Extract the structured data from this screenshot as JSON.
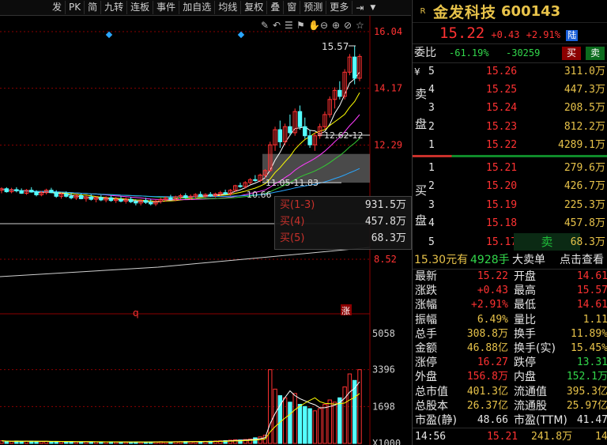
{
  "toolbar": {
    "items": [
      "发",
      "PK",
      "简",
      "九转",
      "连板",
      "事件",
      "加自选",
      "均线",
      "复权",
      "叠",
      "窗",
      "预测",
      "更多"
    ],
    "icons": [
      "pin-right-icon",
      "dropdown-triangle-icon"
    ]
  },
  "colors": {
    "up": "#ff3232",
    "down": "#54ffff",
    "ma5": "#ffffff",
    "ma10": "#ffff00",
    "ma20": "#ff3cff",
    "ma30": "#33cc33",
    "ma60": "#2aa7ff",
    "ma120": "#d0d0d0",
    "bg": "#000000",
    "grid": "#8b0000"
  },
  "price_axis": {
    "ticks": [
      "16.04",
      "14.17",
      "12.29",
      "8.52"
    ]
  },
  "volume_axis": {
    "ticks": [
      "5058",
      "3396",
      "1698",
      "X1000"
    ]
  },
  "chart_data": {
    "type": "candlestick",
    "price_range": [
      8.52,
      16.04
    ],
    "volume_range": [
      0,
      5058
    ],
    "annotations": {
      "high": "15.57",
      "range1": "12.62-12",
      "range2": "11.05-11.83",
      "low": "10.66",
      "marker_q": "q",
      "marker_zhang": "涨"
    },
    "candles": [
      [
        10.8,
        10.9,
        10.7,
        10.85
      ],
      [
        10.85,
        10.9,
        10.72,
        10.75
      ],
      [
        10.75,
        10.88,
        10.7,
        10.82
      ],
      [
        10.82,
        10.9,
        10.73,
        10.78
      ],
      [
        10.78,
        10.86,
        10.68,
        10.7
      ],
      [
        10.7,
        10.84,
        10.65,
        10.8
      ],
      [
        10.8,
        10.9,
        10.72,
        10.74
      ],
      [
        10.74,
        10.8,
        10.6,
        10.65
      ],
      [
        10.65,
        10.78,
        10.6,
        10.72
      ],
      [
        10.72,
        10.85,
        10.66,
        10.8
      ],
      [
        10.8,
        10.88,
        10.7,
        10.72
      ],
      [
        10.72,
        10.8,
        10.55,
        10.6
      ],
      [
        10.6,
        10.72,
        10.52,
        10.68
      ],
      [
        10.68,
        10.76,
        10.56,
        10.6
      ],
      [
        10.6,
        10.7,
        10.5,
        10.55
      ],
      [
        10.55,
        10.68,
        10.48,
        10.62
      ],
      [
        10.62,
        10.7,
        10.5,
        10.52
      ],
      [
        10.52,
        10.62,
        10.42,
        10.58
      ],
      [
        10.58,
        10.66,
        10.46,
        10.5
      ],
      [
        10.5,
        10.6,
        10.4,
        10.56
      ],
      [
        10.56,
        10.64,
        10.44,
        10.48
      ],
      [
        10.48,
        10.6,
        10.4,
        10.55
      ],
      [
        10.55,
        10.62,
        10.42,
        10.46
      ],
      [
        10.46,
        10.58,
        10.38,
        10.5
      ],
      [
        10.5,
        10.6,
        10.4,
        10.44
      ],
      [
        10.44,
        10.56,
        10.36,
        10.5
      ],
      [
        10.5,
        10.58,
        10.38,
        10.42
      ],
      [
        10.42,
        10.5,
        10.3,
        10.38
      ],
      [
        10.38,
        10.5,
        10.3,
        10.46
      ],
      [
        10.46,
        10.55,
        10.35,
        10.4
      ],
      [
        10.4,
        10.5,
        10.3,
        10.35
      ],
      [
        10.35,
        10.48,
        10.28,
        10.44
      ],
      [
        10.44,
        10.55,
        10.36,
        10.5
      ],
      [
        10.5,
        10.6,
        10.42,
        10.55
      ],
      [
        10.55,
        10.65,
        10.46,
        10.5
      ],
      [
        10.5,
        10.62,
        10.44,
        10.58
      ],
      [
        10.58,
        10.68,
        10.5,
        10.62
      ],
      [
        10.62,
        10.7,
        10.52,
        10.56
      ],
      [
        10.56,
        10.66,
        10.48,
        10.6
      ],
      [
        10.6,
        10.7,
        10.52,
        10.66
      ],
      [
        10.66,
        10.76,
        10.58,
        10.6
      ],
      [
        10.6,
        10.7,
        10.55,
        10.66
      ],
      [
        10.66,
        10.74,
        10.58,
        10.62
      ],
      [
        10.62,
        10.72,
        10.56,
        10.68
      ],
      [
        10.68,
        10.78,
        10.6,
        10.72
      ],
      [
        10.72,
        10.82,
        10.64,
        10.68
      ],
      [
        10.68,
        10.84,
        10.62,
        10.8
      ],
      [
        10.8,
        10.98,
        10.74,
        10.95
      ],
      [
        10.95,
        11.05,
        10.88,
        10.92
      ],
      [
        10.92,
        11.1,
        10.86,
        11.05
      ],
      [
        11.05,
        11.2,
        11.0,
        11.15
      ],
      [
        11.15,
        11.3,
        11.08,
        11.12
      ],
      [
        11.12,
        11.35,
        11.06,
        11.3
      ],
      [
        11.3,
        11.5,
        11.2,
        11.45
      ],
      [
        11.45,
        12.4,
        11.4,
        12.3
      ],
      [
        12.3,
        12.9,
        12.1,
        12.8
      ],
      [
        12.8,
        13.1,
        12.2,
        12.4
      ],
      [
        12.4,
        13.0,
        12.3,
        12.9
      ],
      [
        12.9,
        13.3,
        12.6,
        12.7
      ],
      [
        12.7,
        13.5,
        12.6,
        13.4
      ],
      [
        13.4,
        13.6,
        12.8,
        12.9
      ],
      [
        12.9,
        13.2,
        12.5,
        12.6
      ],
      [
        12.6,
        12.8,
        12.2,
        12.3
      ],
      [
        12.3,
        12.7,
        12.1,
        12.6
      ],
      [
        12.6,
        13.0,
        12.5,
        12.9
      ],
      [
        12.9,
        13.4,
        12.8,
        13.3
      ],
      [
        13.3,
        13.9,
        13.2,
        13.8
      ],
      [
        13.8,
        14.2,
        13.5,
        14.1
      ],
      [
        14.1,
        14.4,
        13.8,
        13.9
      ],
      [
        13.9,
        14.8,
        13.8,
        14.7
      ],
      [
        14.7,
        15.3,
        14.6,
        15.2
      ],
      [
        15.2,
        15.57,
        14.3,
        14.5
      ],
      [
        14.5,
        15.3,
        14.4,
        15.22
      ]
    ],
    "volumes": [
      120,
      100,
      90,
      110,
      95,
      105,
      100,
      80,
      85,
      95,
      90,
      80,
      85,
      75,
      80,
      70,
      75,
      80,
      70,
      75,
      65,
      70,
      75,
      65,
      70,
      60,
      65,
      70,
      60,
      65,
      70,
      75,
      80,
      70,
      75,
      80,
      85,
      90,
      80,
      85,
      90,
      95,
      100,
      110,
      120,
      130,
      150,
      170,
      160,
      180,
      200,
      260,
      300,
      380,
      3396,
      2500,
      2200,
      2100,
      1900,
      2300,
      1800,
      1700,
      1600,
      1500,
      1600,
      1800,
      2000,
      1900,
      2100,
      2600,
      3200,
      2900,
      3396
    ]
  },
  "panel": {
    "badge": "R",
    "stock_name": "金发科技",
    "stock_code": "600143",
    "price": "15.22",
    "change": "+0.43",
    "change_pct": "+2.91%",
    "market_tag": "陆",
    "weibi_label": "委比",
    "weibi_pct": "-61.19%",
    "weicha": "-30259",
    "buy_btn": "买",
    "sell_btn": "卖",
    "currency": "¥",
    "sell_side_label": [
      "卖",
      "盘"
    ],
    "buy_side_label": [
      "买",
      "盘"
    ],
    "asks": [
      {
        "level": "5",
        "price": "15.26",
        "vol": "311.0万"
      },
      {
        "level": "4",
        "price": "15.25",
        "vol": "447.3万"
      },
      {
        "level": "3",
        "price": "15.24",
        "vol": "208.5万"
      },
      {
        "level": "2",
        "price": "15.23",
        "vol": "812.2万"
      },
      {
        "level": "1",
        "price": "15.22",
        "vol": "4289.1万"
      }
    ],
    "bids": [
      {
        "level": "1",
        "price": "15.21",
        "vol": "279.6万"
      },
      {
        "level": "2",
        "price": "15.20",
        "vol": "426.7万"
      },
      {
        "level": "3",
        "price": "15.19",
        "vol": "225.3万"
      },
      {
        "level": "4",
        "price": "15.18",
        "vol": "457.8万"
      },
      {
        "level": "5",
        "price": "15.17",
        "vol": "68.3万"
      }
    ],
    "bid5_tag": "卖",
    "bigorder": {
      "price": "15.30元有",
      "qty": "4928手",
      "label": "大卖单",
      "link": "点击查看"
    },
    "stats": [
      {
        "l1": "最新",
        "v1": "15.22",
        "c1": "red",
        "l2": "开盘",
        "v2": "14.61",
        "c2": "red"
      },
      {
        "l1": "涨跌",
        "v1": "+0.43",
        "c1": "red",
        "l2": "最高",
        "v2": "15.57",
        "c2": "red"
      },
      {
        "l1": "涨幅",
        "v1": "+2.91%",
        "c1": "red",
        "l2": "最低",
        "v2": "14.61",
        "c2": "red"
      },
      {
        "l1": "振幅",
        "v1": "6.49%",
        "c1": "yellow",
        "l2": "量比",
        "v2": "1.11",
        "c2": "yellow"
      },
      {
        "l1": "总手",
        "v1": "308.8万",
        "c1": "yellow",
        "l2": "换手",
        "v2": "11.89%",
        "c2": "yellow"
      },
      {
        "l1": "金额",
        "v1": "46.88亿",
        "c1": "yellow",
        "l2": "换手(实)",
        "v2": "15.45%",
        "c2": "yellow"
      },
      {
        "l1": "涨停",
        "v1": "16.27",
        "c1": "red",
        "l2": "跌停",
        "v2": "13.31",
        "c2": "green"
      },
      {
        "l1": "外盘",
        "v1": "156.8万",
        "c1": "red",
        "l2": "内盘",
        "v2": "152.1万",
        "c2": "green"
      },
      {
        "l1": "总市值",
        "v1": "401.3亿",
        "c1": "yellow",
        "l2": "流通值",
        "v2": "395.3亿",
        "c2": "yellow"
      },
      {
        "l1": "总股本",
        "v1": "26.37亿",
        "c1": "yellow",
        "l2": "流通股",
        "v2": "25.97亿",
        "c2": "yellow"
      },
      {
        "l1": "市盈(静)",
        "v1": "48.66",
        "c1": "white",
        "l2": "市盈(TTM)",
        "v2": "41.47",
        "c2": "white"
      }
    ],
    "tick": {
      "time": "14:56",
      "price": "15.21",
      "vol": "241.8万",
      "extra": "14"
    }
  },
  "popup": {
    "rows": [
      {
        "label": "买(1-3)",
        "value": "931.5万"
      },
      {
        "label": "买(4)",
        "value": "457.8万"
      },
      {
        "label": "买(5)",
        "value": "68.3万"
      }
    ]
  }
}
